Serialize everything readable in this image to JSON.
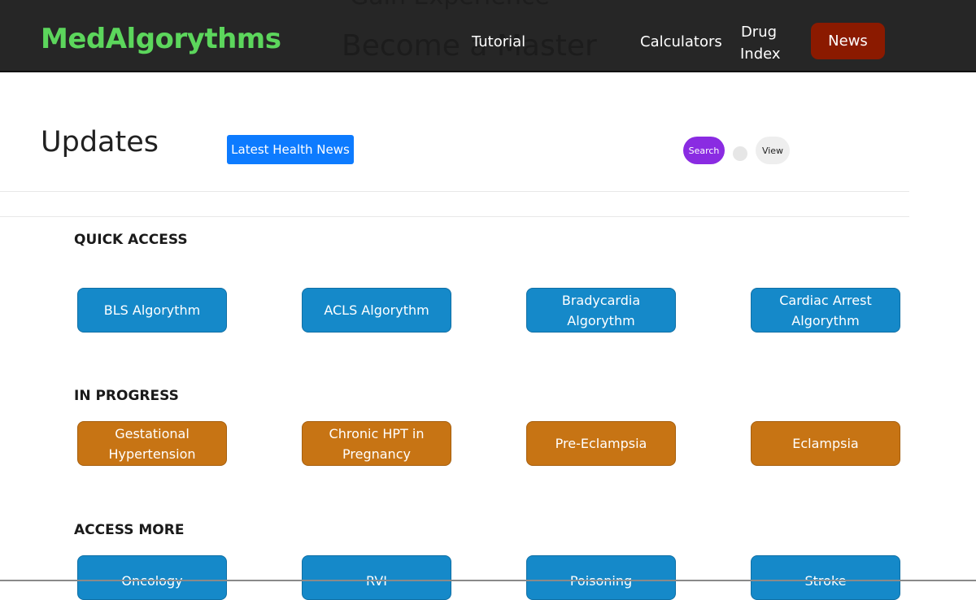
{
  "header": {
    "brand": "MedAlgorythms",
    "nav": {
      "tutorial": "Tutorial",
      "calculators": "Calculators",
      "drug_index_line1": "Drug",
      "drug_index_line2": "Index",
      "news": "News"
    },
    "background_text_1": "Gain Experience",
    "background_text_2": "Become a Master"
  },
  "updates": {
    "title": "Updates",
    "latest_button": "Latest Health News",
    "search_label": "Search",
    "view_label": "View"
  },
  "sections": {
    "quick_access": {
      "heading": "QUICK ACCESS",
      "items": [
        "BLS Algorythm",
        "ACLS Algorythm",
        "Bradycardia Algorythm",
        "Cardiac Arrest Algorythm"
      ]
    },
    "in_progress": {
      "heading": "IN PROGRESS",
      "items": [
        "Gestational Hypertension",
        "Chronic HPT in Pregnancy",
        "Pre-Eclampsia",
        "Eclampsia"
      ]
    },
    "access_more": {
      "heading": "ACCESS MORE",
      "items": [
        "Oncology",
        "RVI",
        "Poisoning",
        "Stroke"
      ]
    }
  },
  "colors": {
    "navbar": "#262626",
    "brand": "#5cd65c",
    "news_button": "#8b1a00",
    "primary_button": "#0d7bff",
    "search_pill": "#8a2be2",
    "tile_blue": "#1589c9",
    "tile_orange": "#c77414"
  }
}
